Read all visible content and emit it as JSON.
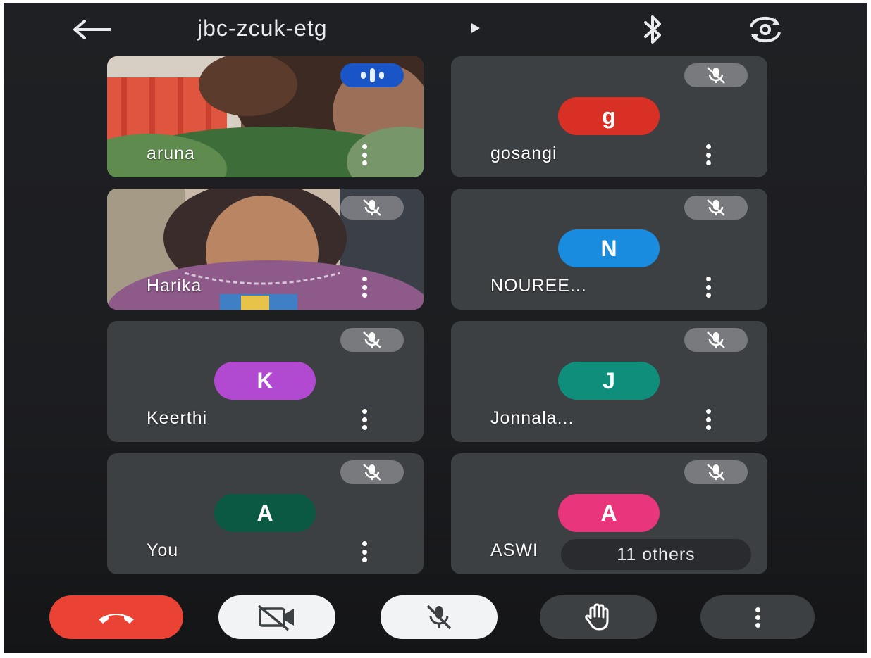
{
  "header": {
    "meeting_code": "jbc-zcuk-etg",
    "back_icon": "arrow-left-icon",
    "expand_icon": "caret-right-icon",
    "bluetooth_icon": "bluetooth-icon",
    "switch_camera_icon": "switch-camera-icon"
  },
  "participants": [
    {
      "name": "aruna",
      "video": true,
      "status": "speaking"
    },
    {
      "name": "gosangi",
      "initial": "g",
      "avatar_color": "#d93025",
      "status": "muted"
    },
    {
      "name": "Harika",
      "video": true,
      "status": "muted"
    },
    {
      "name": "NOUREE...",
      "initial": "N",
      "avatar_color": "#1a8ce0",
      "status": "muted"
    },
    {
      "name": "Keerthi",
      "initial": "K",
      "avatar_color": "#b24ad1",
      "status": "muted"
    },
    {
      "name": "Jonnala...",
      "initial": "J",
      "avatar_color": "#0f8f7b",
      "status": "muted"
    },
    {
      "name": "You",
      "initial": "A",
      "avatar_color": "#0b5843",
      "status": "muted"
    },
    {
      "name": "ASWI",
      "initial": "A",
      "avatar_color": "#e8357c",
      "status": "muted"
    }
  ],
  "others_label": "11 others",
  "controls": {
    "end_call_icon": "end-call-icon",
    "camera_icon": "camera-off-icon",
    "mic_icon": "mic-off-icon",
    "hand_icon": "raise-hand-icon",
    "more_icon": "more-options-icon"
  },
  "colors": {
    "background": "#1f2023",
    "tile": "#3c4043",
    "end_call": "#ea4335",
    "speaking": "#1a55c8"
  }
}
